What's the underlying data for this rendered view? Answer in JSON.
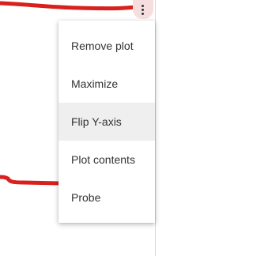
{
  "plot": {
    "line_color": "#d8211e"
  },
  "toolbar": {
    "menu_button_icon": "kebab-vertical-icon"
  },
  "menu": {
    "items": [
      {
        "label": "Remove plot",
        "highlighted": false
      },
      {
        "label": "Maximize",
        "highlighted": false
      },
      {
        "label": "Flip Y-axis",
        "highlighted": true
      },
      {
        "label": "Plot contents",
        "highlighted": false
      },
      {
        "label": "Probe",
        "highlighted": false
      }
    ]
  }
}
